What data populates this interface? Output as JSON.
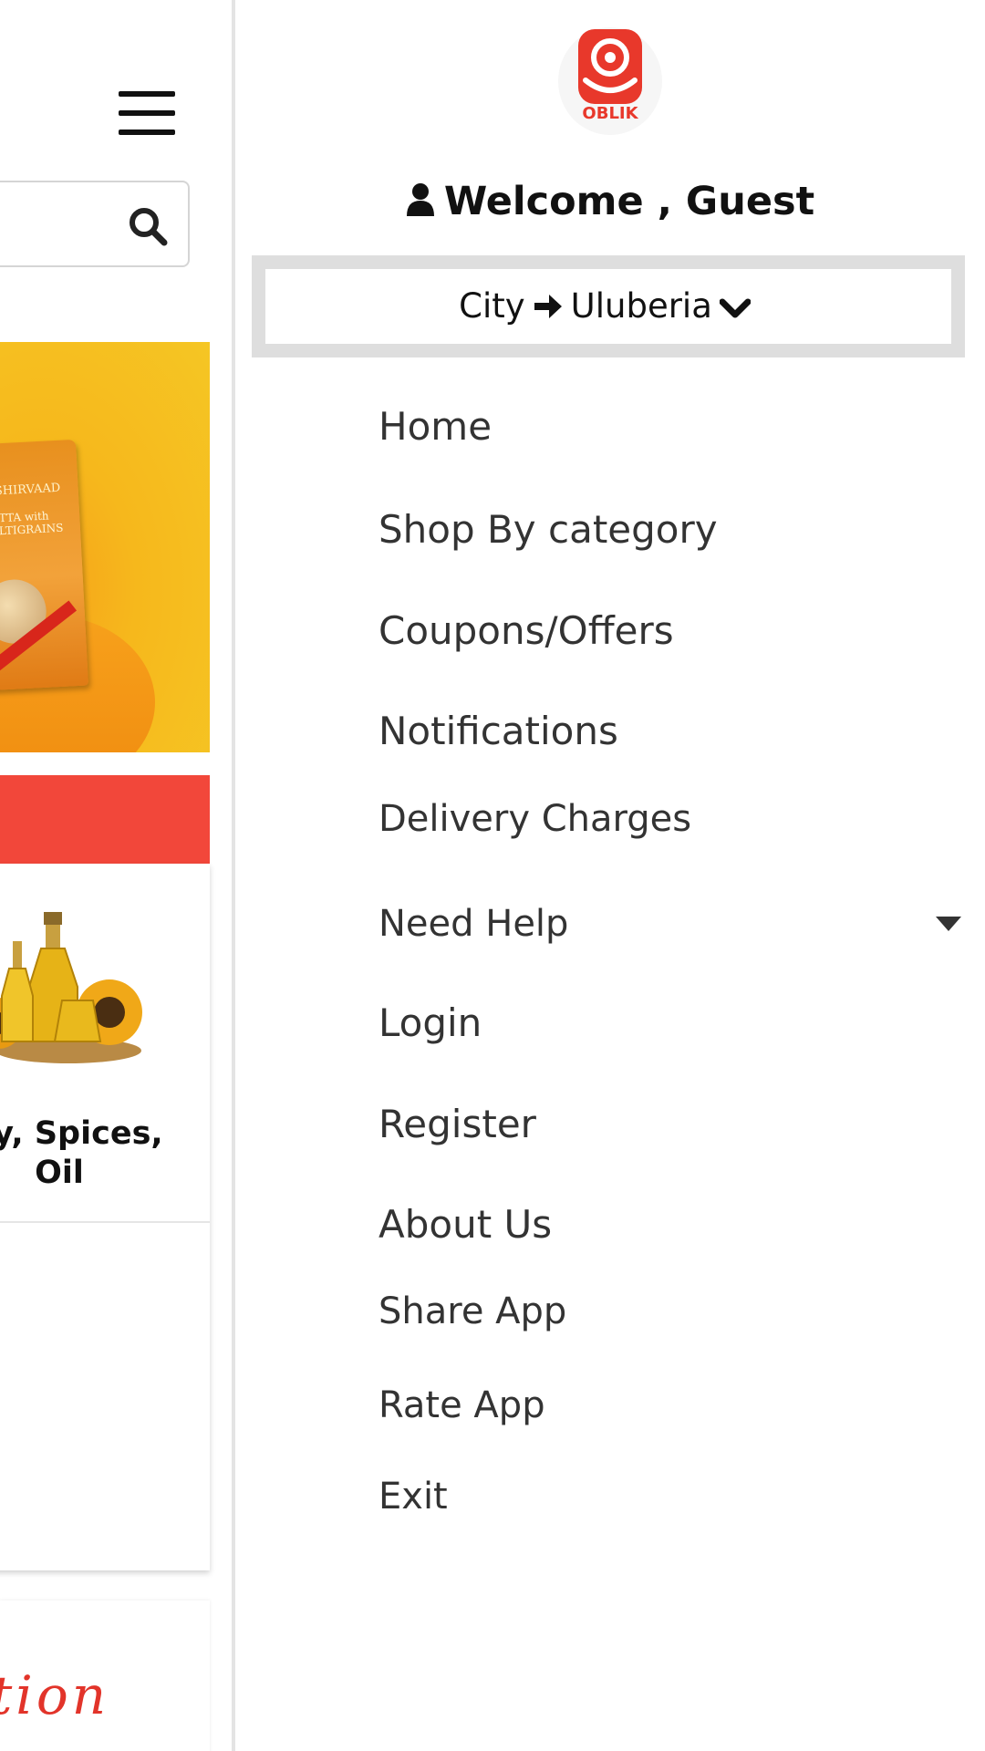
{
  "background_page": {
    "product_label": "ery, Spices, Oil",
    "product_label_line1": "ery, Spices,",
    "product_label_line2": "Oil",
    "script_text": "tion",
    "banner_pack_text1": "AASHIRVAAD",
    "banner_pack_text2": "ATTA with MULTIGRAINS",
    "icons": {
      "menu": "hamburger-icon",
      "search": "search-icon"
    },
    "colors": {
      "banner": "#f5c624",
      "red_strip": "#f2473a"
    }
  },
  "drawer": {
    "logo_text": "OBLIK",
    "welcome_text": "Welcome , Guest",
    "city": {
      "label": "City",
      "value": "Uluberia"
    },
    "menu": [
      {
        "label": "Home"
      },
      {
        "label": "Shop By category"
      },
      {
        "label": "Coupons/Offers"
      },
      {
        "label": "Notifications"
      },
      {
        "label": "Delivery Charges"
      },
      {
        "label": "Need Help",
        "has_dropdown": true
      },
      {
        "label": "Login"
      },
      {
        "label": "Register"
      },
      {
        "label": "About Us"
      },
      {
        "label": "Share App"
      },
      {
        "label": "Rate App"
      },
      {
        "label": "Exit"
      }
    ],
    "colors": {
      "brand": "#e8382b",
      "city_frame": "#dedede",
      "menu_text": "#333333"
    }
  }
}
